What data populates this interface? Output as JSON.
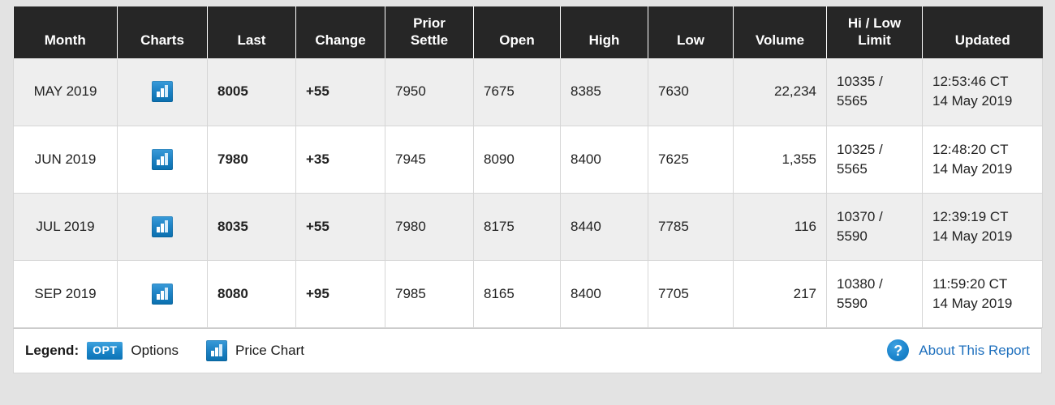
{
  "table": {
    "columns": [
      {
        "key": "month",
        "label": "Month"
      },
      {
        "key": "charts",
        "label": "Charts"
      },
      {
        "key": "last",
        "label": "Last"
      },
      {
        "key": "change",
        "label": "Change"
      },
      {
        "key": "prior",
        "label": "Prior Settle"
      },
      {
        "key": "open",
        "label": "Open"
      },
      {
        "key": "high",
        "label": "High"
      },
      {
        "key": "low",
        "label": "Low"
      },
      {
        "key": "volume",
        "label": "Volume"
      },
      {
        "key": "limit",
        "label": "Hi / Low Limit"
      },
      {
        "key": "updated",
        "label": "Updated"
      }
    ],
    "header_labels": {
      "month": "Month",
      "charts": "Charts",
      "last": "Last",
      "change": "Change",
      "prior_line1": "Prior",
      "prior_line2": "Settle",
      "open": "Open",
      "high": "High",
      "low": "Low",
      "volume": "Volume",
      "limit_line1": "Hi / Low",
      "limit_line2": "Limit",
      "updated": "Updated"
    },
    "rows": [
      {
        "month": "MAY 2019",
        "chart_icon": "price-chart-icon",
        "last": "8005",
        "change": "+55",
        "prior_settle": "7950",
        "open": "7675",
        "high": "8385",
        "low": "7630",
        "volume": "22,234",
        "limit_hi": "10335 /",
        "limit_lo": "5565",
        "updated_time": "12:53:46 CT",
        "updated_date": "14 May 2019"
      },
      {
        "month": "JUN 2019",
        "chart_icon": "price-chart-icon",
        "last": "7980",
        "change": "+35",
        "prior_settle": "7945",
        "open": "8090",
        "high": "8400",
        "low": "7625",
        "volume": "1,355",
        "limit_hi": "10325 /",
        "limit_lo": "5565",
        "updated_time": "12:48:20 CT",
        "updated_date": "14 May 2019"
      },
      {
        "month": "JUL 2019",
        "chart_icon": "price-chart-icon",
        "last": "8035",
        "change": "+55",
        "prior_settle": "7980",
        "open": "8175",
        "high": "8440",
        "low": "7785",
        "volume": "116",
        "limit_hi": "10370 /",
        "limit_lo": "5590",
        "updated_time": "12:39:19 CT",
        "updated_date": "14 May 2019"
      },
      {
        "month": "SEP 2019",
        "chart_icon": "price-chart-icon",
        "last": "8080",
        "change": "+95",
        "prior_settle": "7985",
        "open": "8165",
        "high": "8400",
        "low": "7705",
        "volume": "217",
        "limit_hi": "10380 /",
        "limit_lo": "5590",
        "updated_time": "11:59:20 CT",
        "updated_date": "14 May 2019"
      }
    ]
  },
  "legend": {
    "label": "Legend:",
    "options_badge": "OPT",
    "options_text": "Options",
    "price_chart_text": "Price Chart",
    "help_icon": "question-mark-icon",
    "about_link": "About This Report"
  },
  "colors": {
    "header_background": "#262626",
    "row_alt_background": "#eeeeee",
    "row_background": "#ffffff",
    "change_positive": "#16a135",
    "link": "#1d6fbd",
    "icon_blue": "#1b86c9",
    "page_background": "#e3e3e3"
  }
}
